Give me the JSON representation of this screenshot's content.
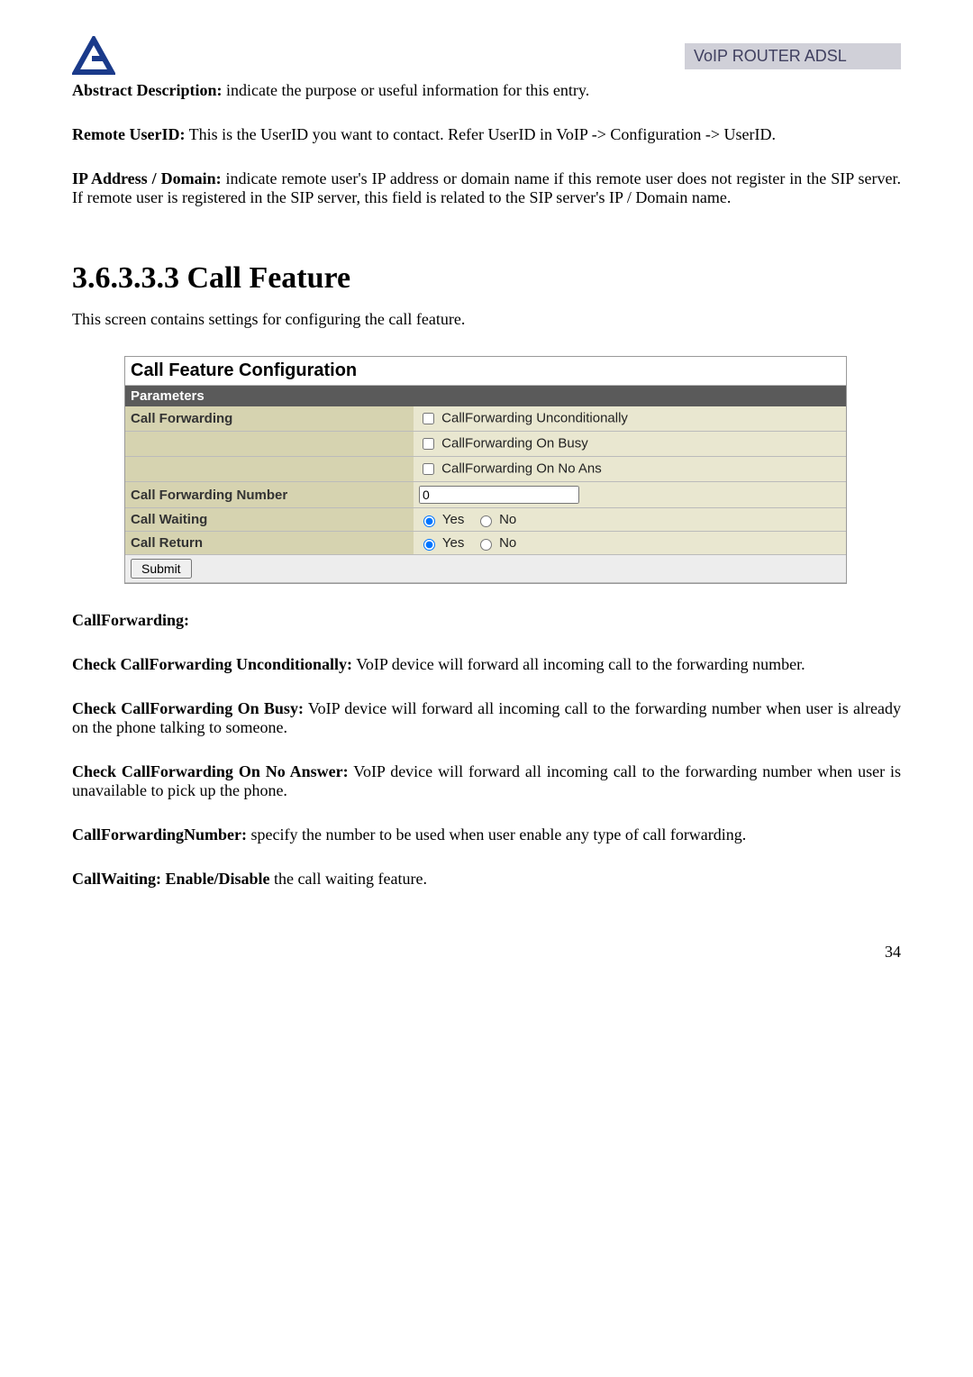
{
  "header": {
    "brand": "VoIP ROUTER ADSL"
  },
  "intro": {
    "abstract_label": "Abstract Description:",
    "abstract_text": " indicate the purpose or useful information for this entry.",
    "remote_label": "Remote UserID:",
    "remote_text": " This is the UserID you want to contact. Refer UserID in VoIP -> Configuration -> UserID.",
    "ipdomain_label": "IP Address / Domain:",
    "ipdomain_text": " indicate remote user's IP address or domain name if this remote user does not register in the SIP server. If remote user is registered in the SIP server, this field is related to the SIP server's IP / Domain name."
  },
  "section": {
    "title": "3.6.3.3.3 Call Feature",
    "subtitle": "This screen contains settings for configuring the call feature."
  },
  "cfg": {
    "title": "Call Feature Configuration",
    "params_label": "Parameters",
    "rows": {
      "call_forwarding_label": "Call Forwarding",
      "cf_uncond": "CallForwarding Unconditionally",
      "cf_busy": "CallForwarding On Busy",
      "cf_noans": "CallForwarding On No Ans",
      "cf_number_label": "Call Forwarding Number",
      "cf_number_value": "0",
      "call_waiting_label": "Call Waiting",
      "call_return_label": "Call Return",
      "yes": "Yes",
      "no": "No"
    },
    "submit": "Submit"
  },
  "body2": {
    "cf_heading": "CallForwarding:",
    "cf_uncond_label": "Check CallForwarding Unconditionally:",
    "cf_uncond_text": " VoIP device will forward all incoming call to the forwarding number.",
    "cf_busy_label": "Check CallForwarding On Busy:",
    "cf_busy_text": " VoIP device will forward all incoming call to the forwarding number when user is already on the phone talking to someone.",
    "cf_noans_label": "Check CallForwarding On No Answer:",
    "cf_noans_text": " VoIP device will forward all incoming call to the forwarding number when user is unavailable to pick up the phone.",
    "cfn_label": "CallForwardingNumber:",
    "cfn_text": " specify the number to be used when user enable any type of call forwarding.",
    "cw_label": "CallWaiting: Enable/Disable",
    "cw_text": " the call waiting feature."
  },
  "page_number": "34"
}
